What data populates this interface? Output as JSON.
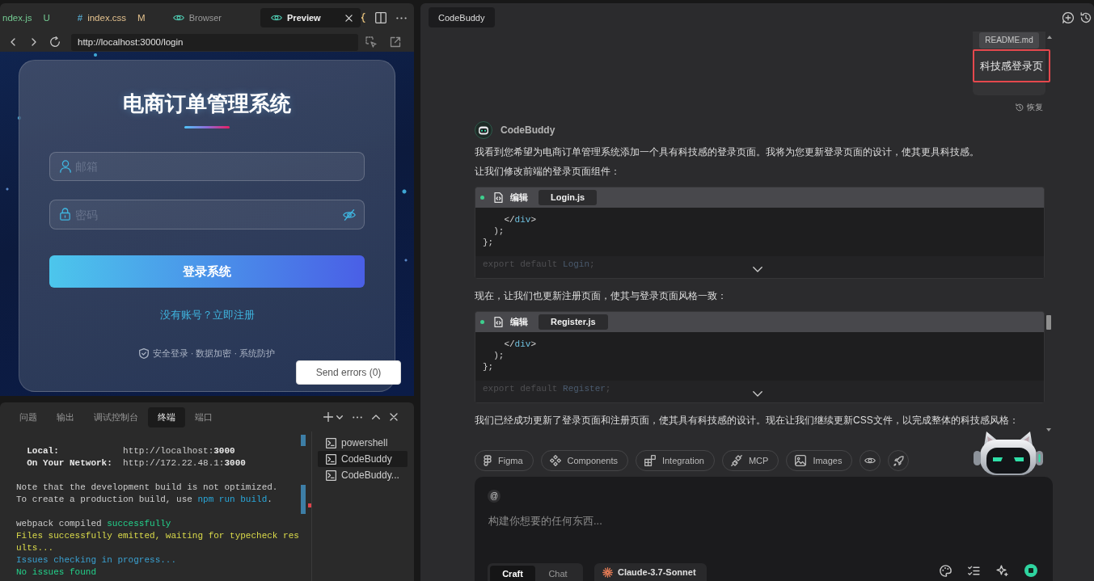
{
  "editor_tabs": [
    {
      "kind": "file",
      "label": "ndex.js",
      "badge": "U",
      "color": "#73c991",
      "selected": false
    },
    {
      "kind": "file",
      "glyph": "#",
      "label": "index.css",
      "badge": "M",
      "color": "#e2c08d",
      "selected": false
    },
    {
      "kind": "view",
      "label": "Browser",
      "selected": false
    },
    {
      "kind": "view",
      "label": "Preview",
      "selected": true
    }
  ],
  "address_bar": {
    "url": "http://localhost:3000/login"
  },
  "login_preview": {
    "title": "电商订单管理系统",
    "fields": [
      {
        "kind": "account",
        "placeholder": "邮箱"
      },
      {
        "kind": "password",
        "placeholder": "密码"
      }
    ],
    "submit": "登录系统",
    "register_link": "没有账号？立即注册",
    "footer": "安全登录 · 数据加密 · 系统防护",
    "send_errors": "Send errors (0)"
  },
  "panel": {
    "tabs": [
      {
        "label": "问题",
        "selected": false
      },
      {
        "label": "输出",
        "selected": false
      },
      {
        "label": "调试控制台",
        "selected": false
      },
      {
        "label": "终端",
        "selected": true
      },
      {
        "label": "端口",
        "selected": false
      }
    ],
    "terminal_groups": [
      {
        "lines": [
          {
            "spans": [
              {
                "text": "  Local:",
                "kind": "bold"
              },
              {
                "text": "            http://localhost:",
                "kind": "plain"
              },
              {
                "text": "3000",
                "kind": "bold"
              }
            ]
          },
          {
            "spans": [
              {
                "text": "  On Your Network:",
                "kind": "bold"
              },
              {
                "text": "  http://172.22.48.1:",
                "kind": "plain"
              },
              {
                "text": "3000",
                "kind": "bold"
              }
            ]
          }
        ]
      },
      {
        "lines": [
          {
            "spans": [
              {
                "text": "Note that the development build is not optimized.",
                "kind": "plain"
              }
            ]
          },
          {
            "spans": [
              {
                "text": "To create a production build, use ",
                "kind": "plain"
              },
              {
                "text": "npm run build",
                "kind": "link"
              },
              {
                "text": ".",
                "kind": "plain"
              }
            ]
          }
        ]
      },
      {
        "lines": [
          {
            "spans": [
              {
                "text": "webpack compiled ",
                "kind": "plain"
              },
              {
                "text": "successfully",
                "kind": "success"
              }
            ]
          },
          {
            "spans": [
              {
                "text": "Files successfully emitted, waiting for typecheck results...",
                "kind": "warn"
              }
            ]
          },
          {
            "spans": [
              {
                "text": "Issues checking in progress...",
                "kind": "info"
              }
            ]
          },
          {
            "spans": [
              {
                "text": "No issues found",
                "kind": "success"
              }
            ]
          }
        ]
      }
    ],
    "terminals": [
      {
        "label": "powershell",
        "selected": false
      },
      {
        "label": "CodeBuddy",
        "selected": true
      },
      {
        "label": "CodeBuddy...",
        "selected": false
      }
    ]
  },
  "chat": {
    "tab": "CodeBuddy",
    "user_message": {
      "attachment": "README.md",
      "text": "科技感登录页",
      "highlighted": true
    },
    "restore": "恢复",
    "assistant_name": "CodeBuddy",
    "blocks": [
      {
        "kind": "text",
        "text": "我看到您希望为电商订单管理系统添加一个具有科技感的登录页面。我将为您更新登录页面的设计，使其更具科技感。"
      },
      {
        "kind": "text",
        "text": "让我们修改前端的登录页面组件："
      },
      {
        "kind": "code",
        "action": "编辑",
        "file": "Login.js",
        "lines": [
          [
            {
              "text": "    </",
              "kind": "punct"
            },
            {
              "text": "div",
              "kind": "tag"
            },
            {
              "text": ">",
              "kind": "punct"
            }
          ],
          [
            {
              "text": "  );",
              "kind": "punct"
            }
          ],
          [
            {
              "text": "};",
              "kind": "punct"
            }
          ]
        ],
        "tail": [
          {
            "text": "export default ",
            "kind": "keyword"
          },
          {
            "text": "Login",
            "kind": "name"
          },
          {
            "text": ";",
            "kind": "keyword"
          }
        ]
      },
      {
        "kind": "text",
        "text": "现在，让我们也更新注册页面，使其与登录页面风格一致："
      },
      {
        "kind": "code",
        "action": "编辑",
        "file": "Register.js",
        "lines": [
          [
            {
              "text": "    </",
              "kind": "punct"
            },
            {
              "text": "div",
              "kind": "tag"
            },
            {
              "text": ">",
              "kind": "punct"
            }
          ],
          [
            {
              "text": "  );",
              "kind": "punct"
            }
          ],
          [
            {
              "text": "};",
              "kind": "punct"
            }
          ]
        ],
        "tail": [
          {
            "text": "export default ",
            "kind": "keyword"
          },
          {
            "text": "Register",
            "kind": "name"
          },
          {
            "text": ";",
            "kind": "keyword"
          }
        ]
      },
      {
        "kind": "text",
        "text": "我们已经成功更新了登录页面和注册页面，使其具有科技感的设计。现在让我们继续更新CSS文件，以完成整体的科技感风格："
      }
    ],
    "context_chips": [
      {
        "kind": "figma",
        "label": "Figma"
      },
      {
        "kind": "components",
        "label": "Components"
      },
      {
        "kind": "integration",
        "label": "Integration"
      },
      {
        "kind": "mcp",
        "label": "MCP"
      },
      {
        "kind": "images",
        "label": "Images"
      }
    ],
    "composer": {
      "mention": "@",
      "placeholder": "构建你想要的任何东西...",
      "modes": [
        {
          "label": "Craft",
          "selected": true
        },
        {
          "label": "Chat",
          "selected": false
        }
      ],
      "model": "Claude-3.7-Sonnet"
    }
  }
}
